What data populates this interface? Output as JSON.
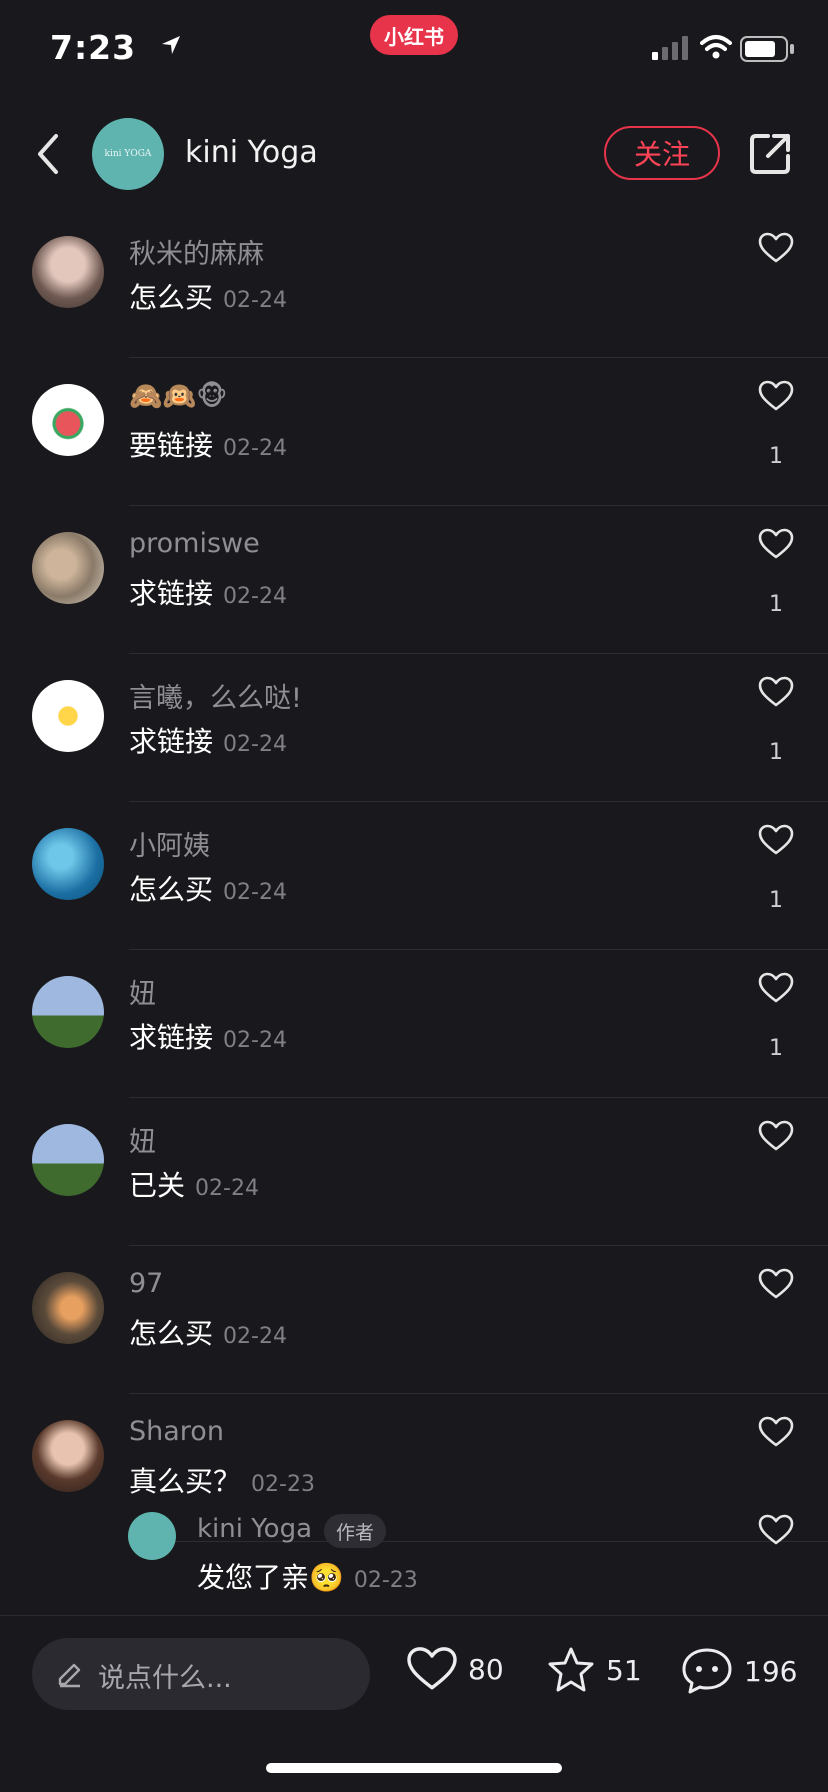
{
  "status_bar": {
    "time": "7:23",
    "app_badge": "小红书"
  },
  "header": {
    "author_name": "kini Yoga",
    "avatar_text": "kini YOGA",
    "follow_label": "关注"
  },
  "comments": [
    {
      "name": "秋米的麻麻",
      "text": "怎么买",
      "date": "02-24",
      "likes": ""
    },
    {
      "name": "🙈🙉🐵",
      "text": "要链接",
      "date": "02-24",
      "likes": "1"
    },
    {
      "name": "promiswe",
      "text": "求链接",
      "date": "02-24",
      "likes": "1"
    },
    {
      "name": "言曦，么么哒!",
      "text": "求链接",
      "date": "02-24",
      "likes": "1"
    },
    {
      "name": "小阿姨",
      "text": "怎么买",
      "date": "02-24",
      "likes": "1"
    },
    {
      "name": "妞",
      "text": "求链接",
      "date": "02-24",
      "likes": "1"
    },
    {
      "name": "妞",
      "text": "已关",
      "date": "02-24",
      "likes": ""
    },
    {
      "name": "97",
      "text": "怎么买",
      "date": "02-24",
      "likes": ""
    },
    {
      "name": "Sharon",
      "text": "真么买？",
      "date": "02-23",
      "likes": ""
    }
  ],
  "reply": {
    "name": "kini Yoga",
    "badge": "作者",
    "text": "发您了亲🥺",
    "date": "02-23"
  },
  "bottom": {
    "placeholder": "说点什么...",
    "likes": "80",
    "stars": "51",
    "comments": "196"
  },
  "colors": {
    "accent": "#e8344a",
    "background": "#19191d",
    "muted": "#8e8e93"
  }
}
